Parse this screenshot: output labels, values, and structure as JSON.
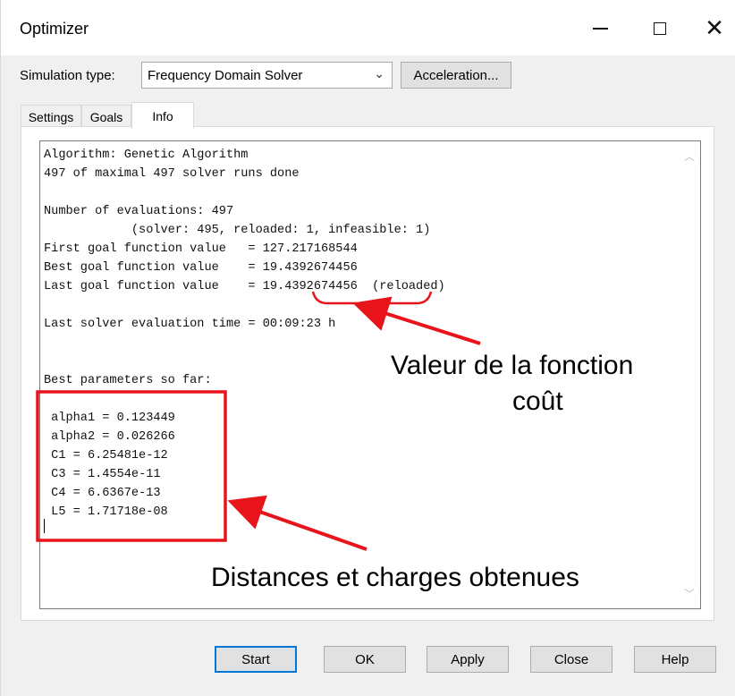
{
  "window": {
    "title": "Optimizer",
    "controls": {
      "minimize": "minimize-icon",
      "maximize": "maximize-icon",
      "close": "close-icon"
    }
  },
  "simulation": {
    "label": "Simulation type:",
    "selected": "Frequency Domain Solver",
    "acceleration_label": "Acceleration..."
  },
  "tabs": [
    {
      "label": "Settings",
      "active": false
    },
    {
      "label": "Goals",
      "active": false
    },
    {
      "label": "Info",
      "active": true
    }
  ],
  "info": {
    "lines": [
      "Algorithm: Genetic Algorithm",
      "497 of maximal 497 solver runs done",
      "",
      "Number of evaluations: 497",
      "            (solver: 495, reloaded: 1, infeasible: 1)",
      "First goal function value   = 127.217168544",
      "Best goal function value    = 19.4392674456",
      "Last goal function value    = 19.4392674456  (reloaded)",
      "",
      "Last solver evaluation time = 00:09:23 h",
      "",
      "",
      "Best parameters so far:",
      "",
      " alpha1 = 0.123449",
      " alpha2 = 0.026266",
      " C1 = 6.25481e-12",
      " C3 = 1.4554e-11",
      " C4 = 6.6367e-13",
      " L5 = 1.71718e-08"
    ]
  },
  "buttons": {
    "start": "Start",
    "ok": "OK",
    "apply": "Apply",
    "close": "Close",
    "help": "Help"
  },
  "annotations": {
    "cost_label_line1": "Valeur de la fonction",
    "cost_label_line2": "coût",
    "params_label": "Distances et charges obtenues",
    "color": "#e8141b"
  }
}
